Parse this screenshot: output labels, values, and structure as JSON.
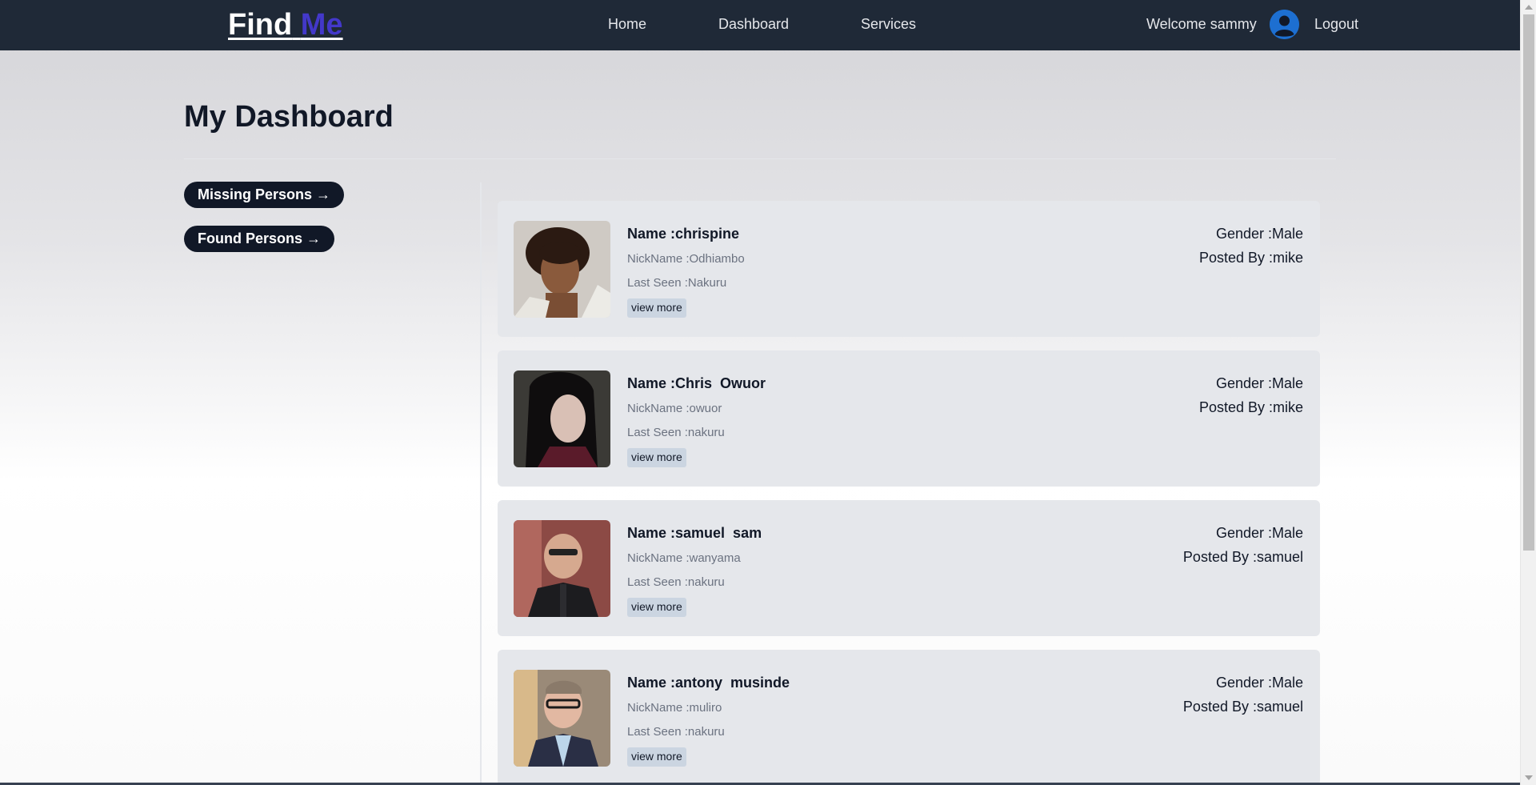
{
  "navbar": {
    "logo_find": "Find",
    "logo_me": "Me",
    "links": [
      "Home",
      "Dashboard",
      "Services"
    ],
    "welcome": "Welcome sammy",
    "logout": "Logout"
  },
  "page": {
    "title": "My Dashboard"
  },
  "sidebar": {
    "missing": "Missing Persons →",
    "found": "Found Persons →"
  },
  "persons": [
    {
      "name": "Name :chrispine",
      "nickname": "NickName :Odhiambo",
      "last_seen": "Last Seen :Nakuru",
      "gender": "Gender :Male",
      "posted_by": "Posted By :mike",
      "view_more": "view more"
    },
    {
      "name": "Name :Chris  Owuor",
      "nickname": "NickName :owuor",
      "last_seen": "Last Seen :nakuru",
      "gender": "Gender :Male",
      "posted_by": "Posted By :mike",
      "view_more": "view more"
    },
    {
      "name": "Name :samuel  sam",
      "nickname": "NickName :wanyama",
      "last_seen": "Last Seen :nakuru",
      "gender": "Gender :Male",
      "posted_by": "Posted By :samuel",
      "view_more": "view more"
    },
    {
      "name": "Name :antony  musinde",
      "nickname": "NickName :muliro",
      "last_seen": "Last Seen :nakuru",
      "gender": "Gender :Male",
      "posted_by": "Posted By :samuel",
      "view_more": "view more"
    }
  ],
  "colors": {
    "navbar_bg": "#1f2937",
    "logo_accent": "#4338ca",
    "pill_bg": "#111827",
    "card_bg": "#e5e7eb",
    "avatar_blue": "#1d6fd1"
  }
}
